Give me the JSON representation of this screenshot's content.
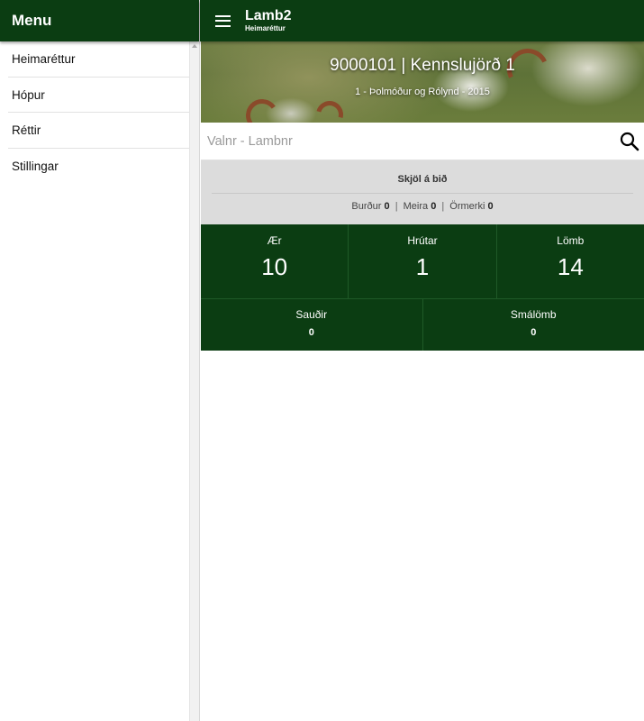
{
  "sidebar": {
    "title": "Menu",
    "items": [
      {
        "label": "Heimaréttur"
      },
      {
        "label": "Hópur"
      },
      {
        "label": "Réttir"
      },
      {
        "label": "Stillingar"
      }
    ]
  },
  "header": {
    "title": "Lamb2",
    "subtitle": "Heimaréttur",
    "menu_icon": "hamburger-icon"
  },
  "banner": {
    "title": "9000101 | Kennslujörð 1",
    "subtitle": "1 - Þolmóður og Rólynd - 2015"
  },
  "search": {
    "placeholder": "Valnr - Lambnr",
    "icon": "search-icon"
  },
  "summary": {
    "title": "Skjöl á bið",
    "items": [
      {
        "label": "Burður",
        "value": "0"
      },
      {
        "label": "Meira",
        "value": "0"
      },
      {
        "label": "Örmerki",
        "value": "0"
      }
    ]
  },
  "stats_primary": [
    {
      "label": "Ær",
      "value": "10"
    },
    {
      "label": "Hrútar",
      "value": "1"
    },
    {
      "label": "Lömb",
      "value": "14"
    }
  ],
  "stats_secondary": [
    {
      "label": "Sauðir",
      "value": "0"
    },
    {
      "label": "Smálömb",
      "value": "0"
    }
  ],
  "colors": {
    "primary": "#0b3d12",
    "summary_bg": "#dcdcdc"
  }
}
